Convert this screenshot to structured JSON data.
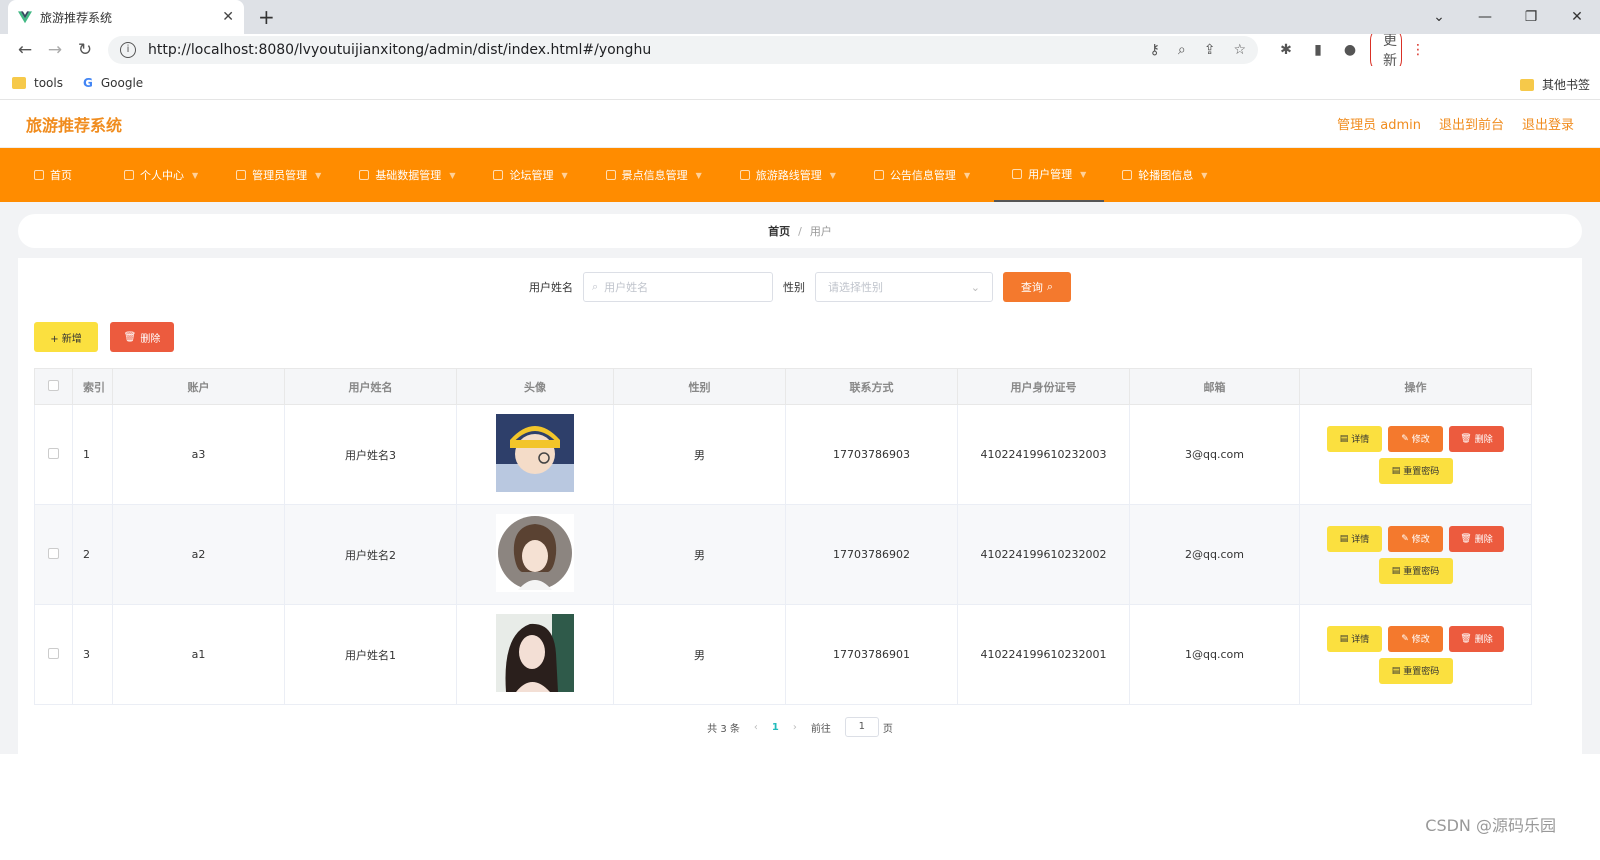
{
  "browser": {
    "tab_title": "旅游推荐系统",
    "url": "http://localhost:8080/lvyoutuijianxitong/admin/dist/index.html#/yonghu",
    "update_label": "更新",
    "bookmarks": [
      "tools",
      "Google"
    ],
    "other_bookmarks": "其他书签"
  },
  "header": {
    "title": "旅游推荐系统",
    "links": [
      "管理员 admin",
      "退出到前台",
      "退出登录"
    ]
  },
  "nav": [
    "首页",
    "个人中心",
    "管理员管理",
    "基础数据管理",
    "论坛管理",
    "景点信息管理",
    "旅游路线管理",
    "公告信息管理",
    "用户管理",
    "轮播图信息"
  ],
  "breadcrumb": {
    "home": "首页",
    "sep": "/",
    "current": "用户"
  },
  "search": {
    "name_label": "用户姓名",
    "name_placeholder": "用户姓名",
    "gender_label": "性别",
    "gender_placeholder": "请选择性别",
    "query_label": "查询"
  },
  "actions": {
    "add": "+ 新增",
    "delete": "删除"
  },
  "table": {
    "headers": [
      "索引",
      "账户",
      "用户姓名",
      "头像",
      "性别",
      "联系方式",
      "用户身份证号",
      "邮箱",
      "操作"
    ],
    "rows": [
      {
        "index": "1",
        "account": "a3",
        "name": "用户姓名3",
        "gender": "男",
        "phone": "17703786903",
        "id_no": "410224199610232003",
        "email": "3@qq.com"
      },
      {
        "index": "2",
        "account": "a2",
        "name": "用户姓名2",
        "gender": "男",
        "phone": "17703786902",
        "id_no": "410224199610232002",
        "email": "2@qq.com"
      },
      {
        "index": "3",
        "account": "a1",
        "name": "用户姓名1",
        "gender": "男",
        "phone": "17703786901",
        "id_no": "410224199610232001",
        "email": "1@qq.com"
      }
    ],
    "op_labels": {
      "detail": "详情",
      "edit": "修改",
      "remove": "删除",
      "reset": "重置密码"
    }
  },
  "pagination": {
    "total": "共 3 条",
    "current": "1",
    "goto": "前往",
    "page_value": "1",
    "page_unit": "页"
  },
  "watermark": "CSDN @源码乐园",
  "colors": {
    "nav": "#ff8c00",
    "brand": "#f08c1e",
    "yellow_btn": "#fbe03f",
    "orange_btn": "#f4792d",
    "red_btn": "#ec5b3e"
  }
}
